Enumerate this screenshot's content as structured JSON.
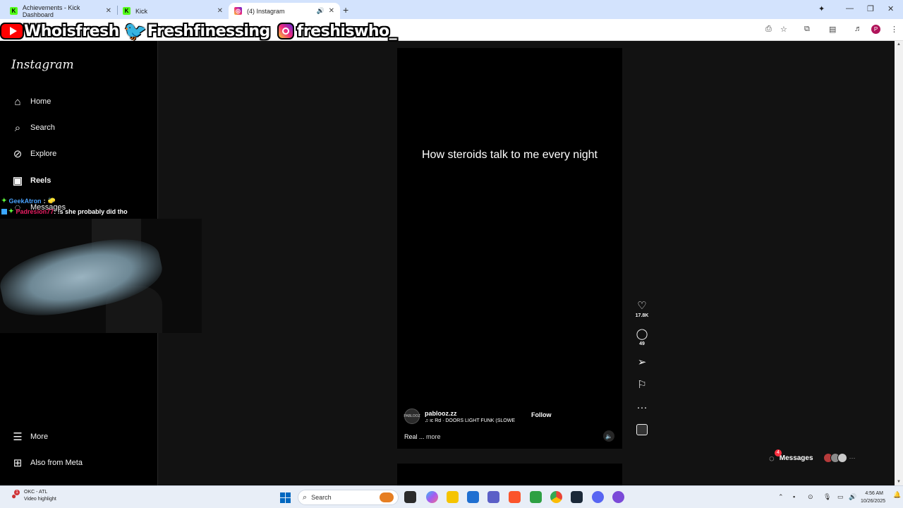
{
  "tabs": [
    {
      "title": "Achievements - Kick Dashboard"
    },
    {
      "title": "Kick"
    },
    {
      "title": "(4) Instagram"
    }
  ],
  "overlay": {
    "youtube_handle": "Whoisfresh",
    "twitter_handle": "Freshfinessing",
    "instagram_handle": "freshiswho_"
  },
  "sidebar": {
    "logo": "Instagram",
    "items": [
      {
        "label": "Home"
      },
      {
        "label": "Search"
      },
      {
        "label": "Explore"
      },
      {
        "label": "Reels"
      },
      {
        "label": "Messages"
      },
      {
        "label": "More"
      },
      {
        "label": "Also from Meta"
      }
    ]
  },
  "chat": {
    "line1_user": "GeekAtron",
    "line1_sep": ":",
    "line2_user": "Padresion77",
    "line2_msg": ": !s she probably did tho"
  },
  "reel": {
    "caption": "How steroids talk to me every night",
    "username": "pablooz.zz",
    "audio": "♫ ic Rd · DOORS LIGHT FUNK (SLOWE",
    "follow_label": "Follow",
    "description": "Real ...",
    "more_label": "more",
    "avatar_text": "PABLOOZ"
  },
  "actions": {
    "likes": "17.8K",
    "comments": "49"
  },
  "messages": {
    "label": "Messages",
    "badge": "4"
  },
  "taskbar": {
    "weather_line1": "OKC - ATL",
    "weather_line2": "Video highlight",
    "weather_badge": "1",
    "search_placeholder": "Search",
    "time": "4:56 AM",
    "date": "10/26/2025"
  },
  "colors": {
    "page_bg": "#121212",
    "sidebar_bg": "#000000",
    "tabbar_bg": "#d3e3fd",
    "notification_red": "#ff3040",
    "kick_green": "#53fc18"
  }
}
